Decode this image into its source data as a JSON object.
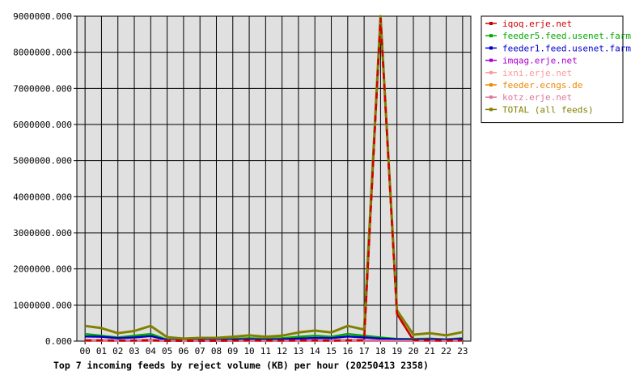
{
  "chart_data": {
    "type": "line",
    "title": "Top 7 incoming feeds by reject volume (KB) per hour (20250413 2358)",
    "x": [
      "00",
      "01",
      "02",
      "03",
      "04",
      "05",
      "06",
      "07",
      "08",
      "09",
      "10",
      "11",
      "12",
      "13",
      "14",
      "15",
      "16",
      "17",
      "18",
      "19",
      "20",
      "21",
      "22",
      "23"
    ],
    "ylim": [
      0,
      9000000
    ],
    "yticks": [
      "0.000",
      "1000000.000",
      "2000000.000",
      "3000000.000",
      "4000000.000",
      "5000000.000",
      "6000000.000",
      "7000000.000",
      "8000000.000",
      "9000000.000"
    ],
    "grid": true,
    "legend_position": "right",
    "series": [
      {
        "name": "iqoq.erje.net",
        "color": "#cc0000",
        "values": [
          20000,
          20000,
          15000,
          15000,
          25000,
          10000,
          8000,
          10000,
          10000,
          15000,
          20000,
          15000,
          15000,
          20000,
          20000,
          15000,
          20000,
          25000,
          8950000,
          750000,
          30000,
          20000,
          15000,
          20000
        ]
      },
      {
        "name": "feeder5.feed.usenet.farm",
        "color": "#00aa00",
        "values": [
          200000,
          150000,
          100000,
          150000,
          200000,
          40000,
          30000,
          40000,
          40000,
          60000,
          80000,
          60000,
          80000,
          120000,
          150000,
          120000,
          200000,
          150000,
          100000,
          60000,
          60000,
          70000,
          50000,
          80000
        ]
      },
      {
        "name": "feeder1.feed.usenet.farm",
        "color": "#0000cc",
        "values": [
          130000,
          120000,
          80000,
          100000,
          140000,
          30000,
          20000,
          30000,
          30000,
          40000,
          50000,
          40000,
          50000,
          70000,
          90000,
          80000,
          130000,
          100000,
          70000,
          50000,
          40000,
          50000,
          40000,
          60000
        ]
      },
      {
        "name": "imqag.erje.net",
        "color": "#aa00cc",
        "values": [
          20000,
          20000,
          15000,
          15000,
          20000,
          10000,
          8000,
          10000,
          10000,
          10000,
          15000,
          10000,
          10000,
          15000,
          15000,
          15000,
          20000,
          15000,
          15000,
          10000,
          10000,
          10000,
          10000,
          15000
        ]
      },
      {
        "name": "ixni.erje.net",
        "color": "#ff9999",
        "values": [
          15000,
          15000,
          10000,
          10000,
          15000,
          8000,
          6000,
          8000,
          8000,
          8000,
          10000,
          8000,
          8000,
          10000,
          10000,
          10000,
          15000,
          10000,
          10000,
          8000,
          8000,
          8000,
          8000,
          10000
        ]
      },
      {
        "name": "feeder.ecngs.de",
        "color": "#ee8800",
        "values": [
          10000,
          10000,
          8000,
          8000,
          10000,
          6000,
          5000,
          6000,
          6000,
          6000,
          8000,
          6000,
          6000,
          8000,
          8000,
          8000,
          10000,
          8000,
          8000,
          6000,
          6000,
          6000,
          6000,
          8000
        ]
      },
      {
        "name": "kotz.erje.net",
        "color": "#dd7799",
        "values": [
          10000,
          10000,
          8000,
          8000,
          10000,
          6000,
          5000,
          6000,
          6000,
          6000,
          8000,
          6000,
          6000,
          8000,
          8000,
          8000,
          10000,
          8000,
          8000,
          6000,
          6000,
          6000,
          6000,
          8000
        ]
      },
      {
        "name": "TOTAL (all feeds)",
        "color": "#808000",
        "values": [
          420000,
          360000,
          220000,
          280000,
          420000,
          110000,
          70000,
          90000,
          90000,
          120000,
          160000,
          120000,
          150000,
          240000,
          290000,
          240000,
          420000,
          320000,
          9000000,
          850000,
          180000,
          220000,
          160000,
          250000
        ]
      }
    ]
  }
}
